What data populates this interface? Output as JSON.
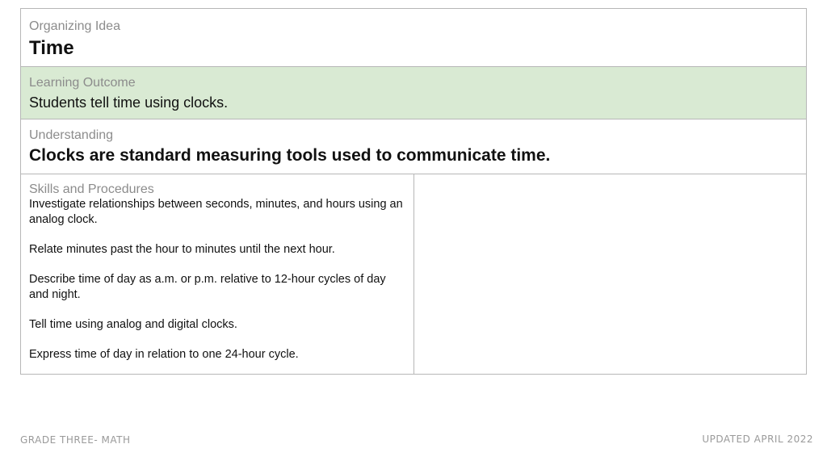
{
  "organizing": {
    "label": "Organizing Idea",
    "value": "Time"
  },
  "outcome": {
    "label": "Learning Outcome",
    "value": "Students tell time using clocks."
  },
  "understanding": {
    "label": "Understanding",
    "value": "Clocks are standard measuring tools used to communicate time."
  },
  "skills": {
    "label": "Skills and Procedures",
    "items": [
      "Investigate relationships between seconds, minutes, and hours using an analog clock.",
      "Relate minutes past the hour to minutes until the next hour.",
      "Describe time of day as a.m. or p.m. relative to 12-hour cycles of day and night.",
      "Tell time using analog and digital clocks.",
      "Express time of day in relation to one 24-hour cycle."
    ]
  },
  "footer": {
    "left": "GRADE THREE- MATH",
    "right": "UPDATED APRIL 2022"
  },
  "colors": {
    "outcome_bg": "#d9ead3",
    "border": "#b7b7b7",
    "label": "#8c8c8c"
  }
}
